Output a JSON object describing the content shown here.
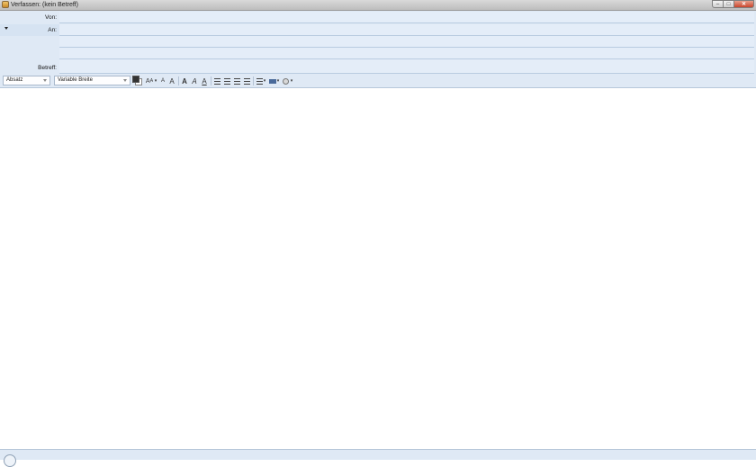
{
  "window": {
    "title": "Verfassen: (kein Betreff)",
    "buttons": {
      "minimize": "–",
      "maximize": "□",
      "close": "✕"
    }
  },
  "header": {
    "from_label": "Von:",
    "to_label": "An:",
    "subject_label": "Betreff:"
  },
  "format": {
    "paragraph_select": "Absatz",
    "font_select": "Variable Breite",
    "buttons": {
      "smaller": "A",
      "larger": "A",
      "bold": "A",
      "italic": "A",
      "underline": "A"
    }
  },
  "colors": {
    "header_bg": "#dfe9f5",
    "field_line": "#b9cbe0",
    "titlebar": "#c8c8c8",
    "close_button": "#c9452c"
  }
}
